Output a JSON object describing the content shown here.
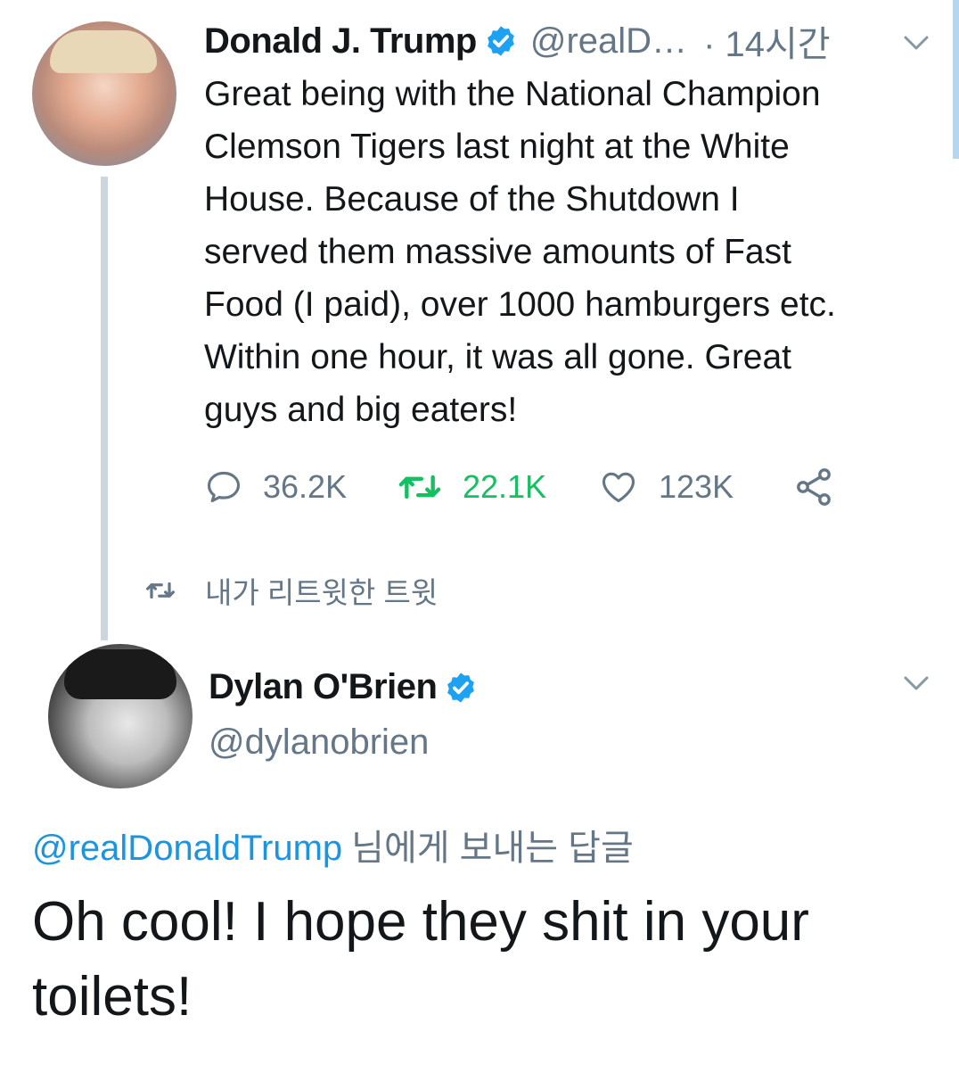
{
  "tweet": {
    "author_name": "Donald J. Trump",
    "handle": "@realD…",
    "time": "· 14시간",
    "text": "Great being with the National Champion\nClemson Tigers last night at the White\nHouse. Because of the Shutdown I\nserved them massive amounts of Fast\nFood (I paid), over 1000 hamburgers etc.\nWithin one hour, it was all gone. Great\nguys and big eaters!",
    "reply_count": "36.2K",
    "retweet_count": "22.1K",
    "like_count": "123K",
    "icons": {
      "verified": "verified-badge-icon",
      "menu": "chevron-down-icon",
      "reply": "reply-icon",
      "retweet": "retweet-icon",
      "like": "heart-icon",
      "share": "share-icon"
    }
  },
  "retweet_context": {
    "label": "내가 리트윗한 트윗",
    "icon": "retweet-icon"
  },
  "reply": {
    "author_name": "Dylan O'Brien",
    "handle": "@dylanobrien",
    "reply_to_handle": "@realDonaldTrump",
    "reply_to_suffix": "님에게 보내는 답글",
    "text": "Oh cool! I hope they shit in your toilets!"
  },
  "colors": {
    "verified": "#1da1f2",
    "link": "#1b95e0",
    "retweet_active": "#17bf63",
    "muted": "#657786",
    "text": "#14171a",
    "thread_line": "#ccd6dd"
  }
}
